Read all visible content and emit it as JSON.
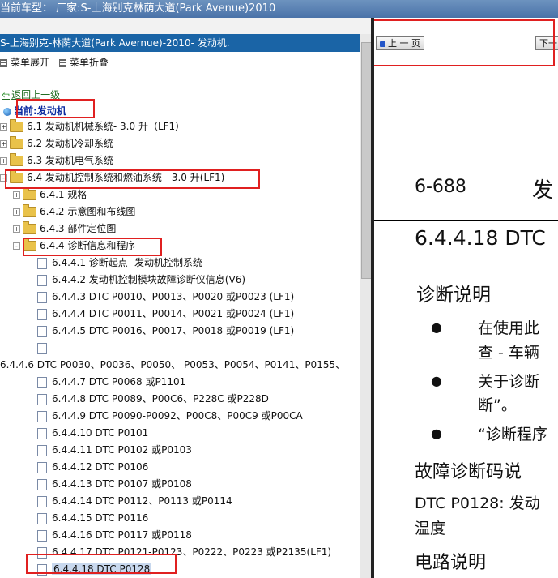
{
  "window": {
    "title": "当前车型：  厂家:S-上海别克林荫大道(Park Avenue)2010"
  },
  "path_bar": "S-上海别克-林荫大道(Park Avernue)-2010- 发动机.",
  "menu": {
    "expand": "菜单展开",
    "collapse": "菜单折叠"
  },
  "nav": {
    "back": "返回上一级",
    "current": "当前:发动机"
  },
  "tree": [
    {
      "label": "6.1 发动机机械系统- 3.0 升（LF1）",
      "type": "folder",
      "toggle": "+"
    },
    {
      "label": "6.2 发动机冷却系统",
      "type": "folder",
      "toggle": "+"
    },
    {
      "label": "6.3 发动机电气系统",
      "type": "folder",
      "toggle": "+"
    },
    {
      "label": "6.4 发动机控制系统和燃油系统 - 3.0 升(LF1)",
      "type": "folder",
      "toggle": "-"
    },
    {
      "label": "6.4.1 规格",
      "type": "folder",
      "toggle": "+"
    },
    {
      "label": "6.4.2 示意图和布线图",
      "type": "folder",
      "toggle": "+"
    },
    {
      "label": "6.4.3 部件定位图",
      "type": "folder",
      "toggle": "+"
    },
    {
      "label": "6.4.4 诊断信息和程序",
      "type": "folder",
      "toggle": "-"
    },
    {
      "label": "6.4.4.1 诊断起点- 发动机控制系统",
      "type": "doc"
    },
    {
      "label": "6.4.4.2 发动机控制模块故障诊断仪信息(V6)",
      "type": "doc"
    },
    {
      "label": "6.4.4.3 DTC P0010、P0013、P0020 或P0023 (LF1)",
      "type": "doc"
    },
    {
      "label": "6.4.4.4 DTC P0011、P0014、P0021 或P0024 (LF1)",
      "type": "doc"
    },
    {
      "label": "6.4.4.5 DTC P0016、P0017、P0018 或P0019 (LF1)",
      "type": "doc"
    },
    {
      "label": "",
      "type": "doc"
    },
    {
      "label": "6.4.4.6 DTC P0030、P0036、P0050、 P0053、P0054、P0141、P0155、",
      "type": "doc-wrap"
    },
    {
      "label": "6.4.4.7 DTC P0068 或P1101",
      "type": "doc"
    },
    {
      "label": "6.4.4.8 DTC P0089、P00C6、P228C 或P228D",
      "type": "doc"
    },
    {
      "label": "6.4.4.9 DTC P0090-P0092、P00C8、P00C9 或P00CA",
      "type": "doc"
    },
    {
      "label": "6.4.4.10 DTC P0101",
      "type": "doc"
    },
    {
      "label": "6.4.4.11 DTC P0102 或P0103",
      "type": "doc"
    },
    {
      "label": "6.4.4.12 DTC P0106",
      "type": "doc"
    },
    {
      "label": "6.4.4.13 DTC P0107 或P0108",
      "type": "doc"
    },
    {
      "label": "6.4.4.14 DTC P0112、P0113 或P0114",
      "type": "doc"
    },
    {
      "label": "6.4.4.15 DTC P0116",
      "type": "doc"
    },
    {
      "label": "6.4.4.16 DTC P0117 或P0118",
      "type": "doc"
    },
    {
      "label": "6.4.4.17 DTC P0121-P0123、P0222、P0223 或P2135(LF1)",
      "type": "doc"
    },
    {
      "label": "6.4.4.18 DTC P0128",
      "type": "doc",
      "selected": true
    }
  ],
  "viewer": {
    "prev_button": "上 一 页",
    "next_button": "下一",
    "page_number": "6-688",
    "page_header": "发",
    "section_title": "6.4.4.18 DTC",
    "diag_heading": "诊断说明",
    "bullet1_line1": "在使用此",
    "bullet1_line2": "查 - 车辆",
    "bullet2_line1": "关于诊断",
    "bullet2_line2": "断”。",
    "bullet3_line1": "“诊断程序",
    "dtc_heading": "故障诊断码说",
    "dtc_line1": "DTC P0128: 发动",
    "dtc_line2": "温度",
    "circuit_heading": "电路说明"
  },
  "colors": {
    "highlight": "#e02020",
    "path_bar": "#1a64a6",
    "folder": "#e9c24a"
  }
}
